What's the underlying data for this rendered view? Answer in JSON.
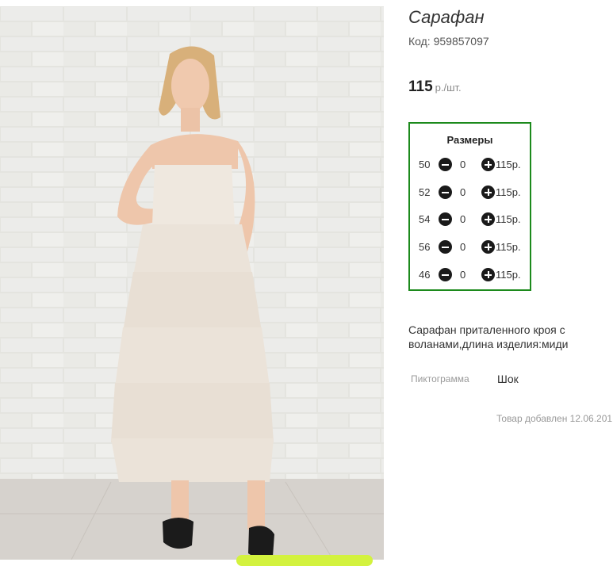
{
  "product": {
    "title": "Сарафан",
    "code_label": "Код:",
    "code_value": "959857097",
    "price_value": "115",
    "price_unit": "р./шт."
  },
  "sizes": {
    "title": "Размеры",
    "rows": [
      {
        "size": "50",
        "qty": "0",
        "price": "115р."
      },
      {
        "size": "52",
        "qty": "0",
        "price": "115р."
      },
      {
        "size": "54",
        "qty": "0",
        "price": "115р."
      },
      {
        "size": "56",
        "qty": "0",
        "price": "115р."
      },
      {
        "size": "46",
        "qty": "0",
        "price": "115р."
      }
    ]
  },
  "description": "Сарафан приталенного кроя с воланами,длина изделия:миди",
  "attribute": {
    "name": "Пиктограмма",
    "value": "Шок"
  },
  "added_text": "Товар добавлен 12.06.201",
  "icons": {
    "decrease": "minus-circle-icon",
    "increase": "plus-circle-icon"
  },
  "colors": {
    "sizes_border": "#1c8a1c",
    "accent_pill": "#d3f23e",
    "button": "#1a1a1a"
  }
}
